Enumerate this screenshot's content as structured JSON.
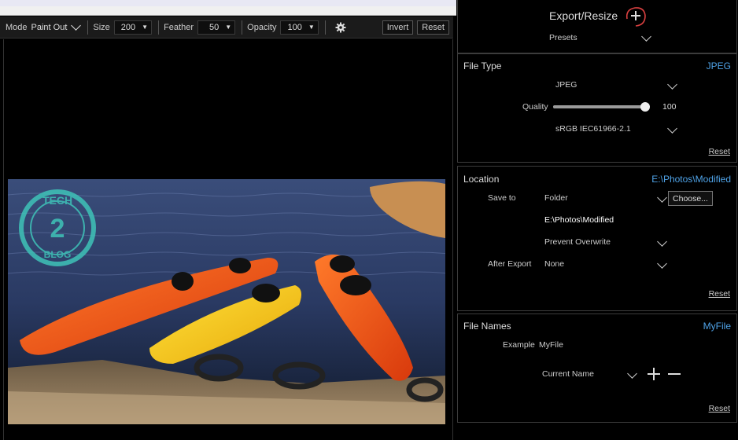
{
  "toolbar": {
    "mode_label": "Mode",
    "mode_value": "Paint Out",
    "size_label": "Size",
    "size_value": "200",
    "feather_label": "Feather",
    "feather_value": "50",
    "opacity_label": "Opacity",
    "opacity_value": "100",
    "invert_label": "Invert",
    "reset_label": "Reset"
  },
  "photo": {
    "watermark": "TECH 2 BLOG"
  },
  "export": {
    "title": "Export/Resize",
    "add_icon": "plus-icon",
    "presets_label": "Presets"
  },
  "file_type": {
    "title": "File Type",
    "value": "JPEG",
    "format_value": "JPEG",
    "quality_label": "Quality",
    "quality_value": "100",
    "quality_fraction": 1.0,
    "color_profile": "sRGB IEC61966-2.1",
    "reset_label": "Reset"
  },
  "location": {
    "title": "Location",
    "value": "E:\\Photos\\Modified",
    "save_to_label": "Save to",
    "save_to_value": "Folder",
    "choose_label": "Choose...",
    "path": "E:\\Photos\\Modified",
    "overwrite_value": "Prevent Overwrite",
    "after_export_label": "After Export",
    "after_export_value": "None",
    "reset_label": "Reset"
  },
  "file_names": {
    "title": "File Names",
    "value": "MyFile",
    "example_label": "Example",
    "example_value": "MyFile",
    "current_name_label": "Current Name",
    "add_icon": "plus-icon",
    "remove_icon": "minus-icon",
    "reset_label": "Reset"
  },
  "colors": {
    "accent": "#4fa3e8",
    "panel_border": "#3c3c3c",
    "highlight_circle": "#d94040"
  }
}
